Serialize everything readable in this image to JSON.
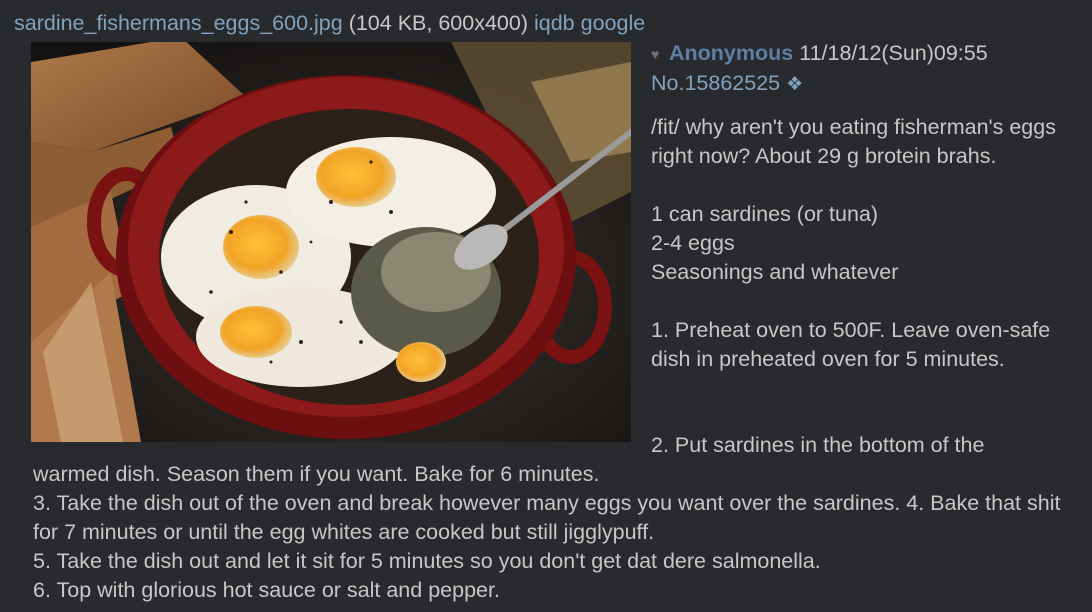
{
  "file": {
    "name": "sardine_fishermans_eggs_600.jpg",
    "info": "(104 KB, 600x400)",
    "iqdb": "iqdb",
    "google": "google"
  },
  "post": {
    "name": "Anonymous",
    "datetime": "11/18/12(Sun)09:55",
    "number": "No.15862525",
    "diamond": "❖",
    "body_intro": "/fit/ why aren't you eating fisherman's eggs right now? About 29 g brotein brahs.\n\n1 can sardines (or tuna)\n2-4 eggs\nSeasonings and whatever\n\n1. Preheat oven to 500F. Leave oven-safe dish in preheated oven for 5 minutes.",
    "step2_start": "2. Put sardines in the bottom of the",
    "body_rest": "warmed dish. Season them if you want. Bake for 6 minutes.\n3. Take the dish out of the oven and break however many eggs you want over the sardines. 4. Bake that shit for 7 minutes or until the egg whites are cooked but still jigglypuff.\n5. Take the dish out and let it sit for 5 minutes so you don't get dat dere salmonella.\n6. Top with glorious hot sauce or salt and pepper."
  },
  "icons": {
    "heart": "heart-icon",
    "diamond": "diamond-icon"
  }
}
